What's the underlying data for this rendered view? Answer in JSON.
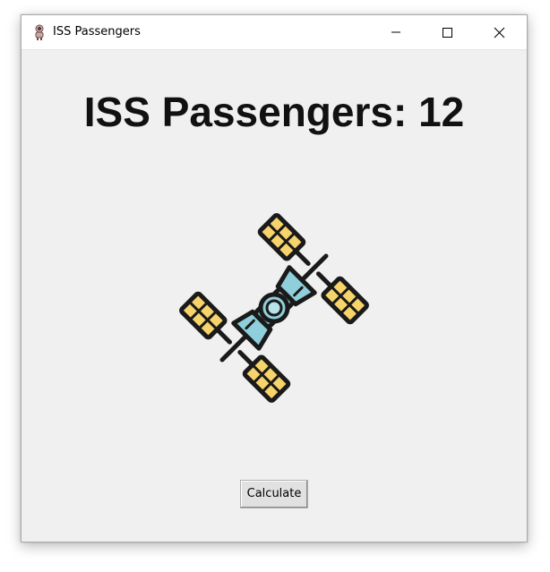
{
  "window": {
    "title": "ISS Passengers",
    "app_icon": "astronaut-icon",
    "controls": {
      "minimize_icon": "minimize-icon",
      "maximize_icon": "maximize-icon",
      "close_icon": "close-icon"
    }
  },
  "main": {
    "heading": "ISS Passengers: 12",
    "image_icon": "space-station-icon",
    "calculate_label": "Calculate"
  },
  "colors": {
    "background": "#f0f0f0",
    "panel_blue": "#8fcfdb",
    "panel_yellow": "#f6d36b",
    "outline": "#1a1a1a"
  }
}
